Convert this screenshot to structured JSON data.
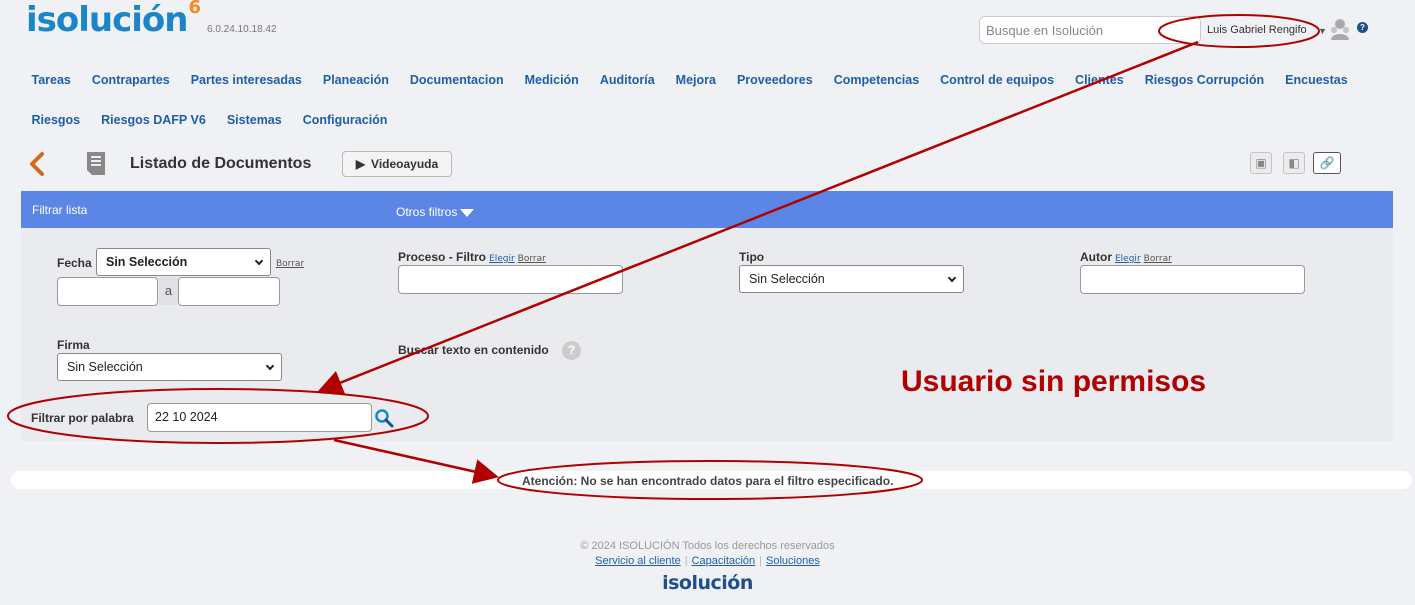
{
  "header": {
    "logo": "isolución",
    "logo_sup": "6",
    "version": "6.0.24.10.18.42",
    "search_placeholder": "Busque en Isolución",
    "user_name": "Luis Gabriel Rengifo",
    "help": "?"
  },
  "nav": {
    "row1": [
      "Tareas",
      "Contrapartes",
      "Partes interesadas",
      "Planeación",
      "Documentacion",
      "Medición",
      "Auditoría",
      "Mejora",
      "Proveedores",
      "Competencias",
      "Control de equipos",
      "Clientes",
      "Riesgos Corrupción",
      "Encuestas"
    ],
    "row2": [
      "Riesgos",
      "Riesgos DAFP V6",
      "Sistemas",
      "Configuración"
    ]
  },
  "toolbar": {
    "title": "Listado de Documentos",
    "video_label": "Videoayuda"
  },
  "filter_bar": {
    "left_label": "Filtrar lista",
    "other_filters": "Otros filtros"
  },
  "filters": {
    "fecha_label": "Fecha",
    "fecha_select": "Sin Selección",
    "borrar": "Borrar",
    "elegir": "Elegir",
    "a_sep": "a",
    "proceso_label": "Proceso - Filtro",
    "tipo_label": "Tipo",
    "tipo_select": "Sin Selección",
    "autor_label": "Autor",
    "firma_label": "Firma",
    "firma_select": "Sin Selección",
    "buscar_texto_label": "Buscar texto en contenido",
    "filtrar_palabra_label": "Filtrar por palabra",
    "filtrar_palabra_value": "22 10 2024"
  },
  "message": {
    "attention": "Atención: No se han encontrado datos para el filtro especificado."
  },
  "annotation": {
    "text": "Usuario sin permisos",
    "color": "#b00000"
  },
  "footer": {
    "copyright": "© 2024 ISOLUCIÓN Todos los derechos reservados",
    "links": [
      "Servicio al cliente",
      "Capacitación",
      "Soluciones"
    ],
    "logo": "isolución"
  },
  "colors": {
    "brand_blue": "#1a86c8",
    "nav_blue": "#1e5fa8",
    "filter_bar": "#5b86e5",
    "back_orange": "#d2691e"
  }
}
